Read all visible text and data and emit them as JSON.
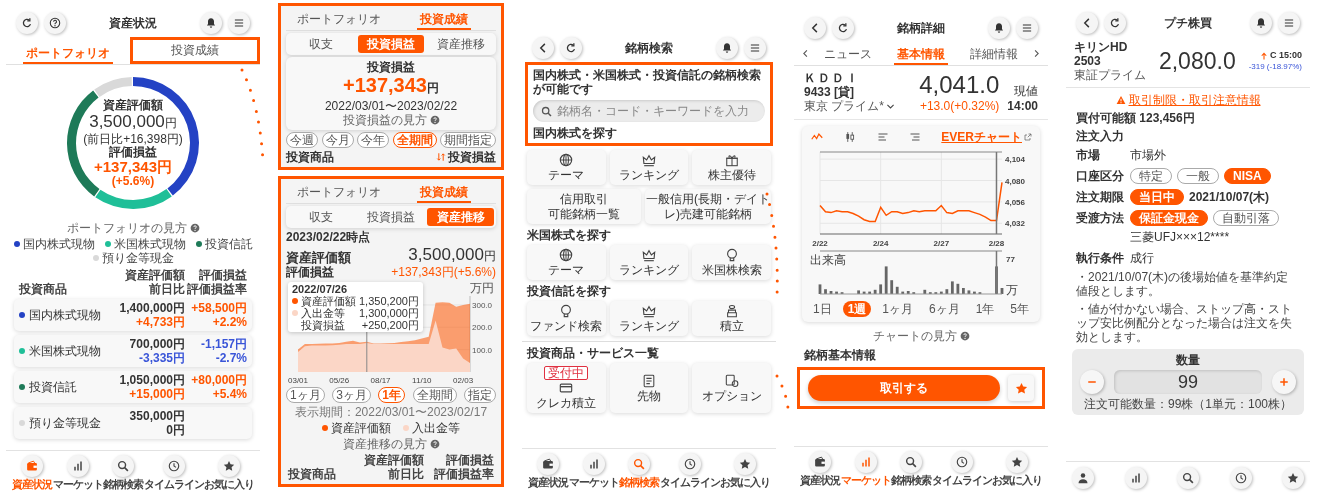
{
  "portfolio_screen": {
    "header": {
      "title": "資産状況",
      "left_icons": [
        {
          "kind": "reload"
        },
        {
          "kind": "help"
        }
      ]
    },
    "tabs": [
      {
        "label": "ポートフォリオ",
        "selected": true,
        "highlighted": false
      },
      {
        "label": "投資成績",
        "selected": false,
        "highlighted": true
      }
    ],
    "chart_data": {
      "type": "donut",
      "categories": [
        "国内株式現物",
        "米国株式現物",
        "投資信託",
        "預り金等現金"
      ],
      "values": [
        40,
        20,
        30,
        10
      ]
    },
    "center": {
      "label": "資産評価額",
      "amount": "3,500,000",
      "unit": "円",
      "day_change": "(前日比+16,398円)",
      "profit_label": "評価損益",
      "profit": "+137,343円",
      "profit_rate": "(+5.6%)"
    },
    "help_link": "ポートフォリオの見方",
    "table": {
      "columns": [
        {
          "lines": [
            "投資商品"
          ]
        },
        {
          "lines": [
            "資産評価額",
            "前日比"
          ]
        },
        {
          "lines": [
            "評価損益",
            "評価損益率"
          ]
        }
      ],
      "rows": [
        {
          "name": "国内株式現物",
          "color": "#2442c4",
          "value": "1,400,000円",
          "day_change": "+4,733円",
          "profit": "+58,500円",
          "profit_rate": "+2.2%",
          "gain": true
        },
        {
          "name": "米国株式現物",
          "color": "#1fbf98",
          "value": "700,000円",
          "day_change": "-3,335円",
          "profit": "-1,157円",
          "profit_rate": "-2.7%",
          "gain": false
        },
        {
          "name": "投資信託",
          "color": "#1e7a58",
          "value": "1,050,000円",
          "day_change": "+15,000円",
          "profit": "+80,000円",
          "profit_rate": "+5.4%",
          "gain": true
        },
        {
          "name": "預り金等現金",
          "color": "#d9d9d9",
          "value": "350,000円",
          "day_change": "0円"
        }
      ]
    },
    "nav": [
      {
        "kind": "wallet",
        "label": "資産状況",
        "selected": true
      },
      {
        "kind": "bars",
        "label": "マーケット",
        "selected": false
      },
      {
        "kind": "search",
        "label": "銘柄検索",
        "selected": false
      },
      {
        "kind": "clock",
        "label": "タイムライン",
        "selected": false
      },
      {
        "kind": "star",
        "label": "お気に入り",
        "selected": false
      }
    ]
  },
  "performance_panels": [
    {
      "kind": "profit",
      "highlighted": true,
      "tabs": [
        {
          "label": "ポートフォリオ",
          "selected": false
        },
        {
          "label": "投資成績",
          "selected": true
        }
      ],
      "segments": [
        {
          "label": "収支",
          "selected": false
        },
        {
          "label": "投資損益",
          "selected": true
        },
        {
          "label": "資産推移",
          "selected": false
        }
      ],
      "summary": {
        "label": "投資損益",
        "amount": "+137,343",
        "unit": "円",
        "period": "2022/03/01〜2023/02/22",
        "help": "投資損益の見方"
      },
      "periods": [
        {
          "label": "今週",
          "selected": false
        },
        {
          "label": "今月",
          "selected": false
        },
        {
          "label": "今年",
          "selected": false
        },
        {
          "label": "全期間",
          "selected": true
        },
        {
          "label": "期間指定",
          "selected": false
        }
      ],
      "list_header": {
        "column_1": "投資商品",
        "sort": "投資損益"
      }
    },
    {
      "kind": "history",
      "highlighted": true,
      "tabs": [
        {
          "label": "ポートフォリオ",
          "selected": false
        },
        {
          "label": "投資成績",
          "selected": true
        }
      ],
      "segments": [
        {
          "label": "収支",
          "selected": false
        },
        {
          "label": "投資損益",
          "selected": false
        },
        {
          "label": "資産推移",
          "selected": true
        }
      ],
      "as_of": "2023/02/22時点",
      "title": "資産評価額",
      "subtitle": "評価損益",
      "amount": "3,500,000",
      "unit": "円",
      "change": "+137,343円(+5.6%)",
      "chart_data": {
        "type": "area",
        "ylabel": "万円",
        "ylim": [
          0,
          340
        ],
        "grid": true,
        "categories": [
          "03/01",
          null,
          null,
          null,
          null,
          null,
          "05/26",
          null,
          null,
          null,
          null,
          null,
          "08/17",
          null,
          null,
          null,
          null,
          null,
          "11/10",
          null,
          null,
          null,
          null,
          null,
          "02/03",
          null
        ],
        "yticks": [
          {
            "value": 100,
            "label": "100.0"
          },
          {
            "value": 200,
            "label": "200.0"
          },
          {
            "value": 300,
            "label": "300.0"
          }
        ],
        "series": [
          {
            "name": "資産評価額",
            "color": "#ff5500",
            "values": [
              100,
              125,
              125,
              126,
              128,
              128,
              130,
              135,
              140,
              132,
              135,
              128,
              128,
              129,
              130,
              134,
              138,
              142,
              150,
              158,
              310,
              312,
              310,
              292,
              300,
              305
            ]
          },
          {
            "name": "入出金等",
            "color": "#fbd6c6",
            "values": [
              90,
              115,
              118,
              118,
              118,
              120,
              122,
              125,
              125,
              125,
              130,
              125,
              125,
              125,
              125,
              125,
              125,
              125,
              125,
              125,
              230,
              110,
              100,
              105,
              60,
              40
            ]
          }
        ]
      },
      "tooltip": {
        "date": "2022/07/26",
        "items": [
          {
            "label": "資産評価額",
            "value": "1,350,200円",
            "color": "#ff5500"
          },
          {
            "label": "入出金等",
            "value": "1,300,000円",
            "color": "#fbd6c6"
          },
          {
            "label": "投資損益",
            "value": "+250,200円"
          }
        ]
      },
      "periods": [
        {
          "label": "1ヶ月",
          "selected": false
        },
        {
          "label": "3ヶ月",
          "selected": false
        },
        {
          "label": "1年",
          "selected": true
        },
        {
          "label": "全期間",
          "selected": false
        },
        {
          "label": "指定",
          "selected": false
        }
      ],
      "display_period": "表示期間：2022/03/01〜2023/02/17",
      "help": "資産推移の見方",
      "columns": [
        {
          "lines": [
            "投資商品"
          ]
        },
        {
          "lines": [
            "資産評価額",
            "前日比"
          ]
        },
        {
          "lines": [
            "評価損益",
            "評価損益率"
          ]
        }
      ]
    }
  ],
  "search_screen": {
    "header": {
      "title": "銘柄検索",
      "left_icons": [
        {
          "kind": "back"
        },
        {
          "kind": "reload"
        }
      ]
    },
    "search_section": {
      "highlighted": true,
      "intro": "国内株式・米国株式・投資信託の銘柄検索が可能です",
      "placeholder": "銘柄名・コード・キーワードを入力"
    },
    "sections": [
      {
        "title": "国内株式を探す",
        "tiles": [
          {
            "kind": "theme",
            "lines": [
              "テーマ"
            ]
          },
          {
            "kind": "ranking",
            "lines": [
              "ランキング"
            ]
          },
          {
            "kind": "benefit",
            "lines": [
              "株主優待"
            ]
          },
          {
            "kind": "text",
            "lines": [
              "信用取引",
              "可能銘柄一覧"
            ]
          },
          {
            "kind": "text",
            "lines": [
              "一般信用(長期・デイト",
              "レ)売建可能銘柄"
            ]
          }
        ]
      },
      {
        "title": "米国株式を探す",
        "tiles": [
          {
            "kind": "theme",
            "lines": [
              "テーマ"
            ]
          },
          {
            "kind": "ranking",
            "lines": [
              "ランキング"
            ]
          },
          {
            "kind": "bulb",
            "lines": [
              "米国株検索"
            ]
          }
        ]
      },
      {
        "title": "投資信託を探す",
        "tiles": [
          {
            "kind": "bulb",
            "lines": [
              "ファンド検索"
            ]
          },
          {
            "kind": "ranking",
            "lines": [
              "ランキング"
            ]
          },
          {
            "kind": "coins",
            "lines": [
              "積立"
            ]
          }
        ]
      },
      {
        "title": "投資商品・サービス一覧",
        "tiles": [
          {
            "kind": "card",
            "lines": [
              "クレカ積立"
            ],
            "badge": "受付中"
          },
          {
            "kind": "futures",
            "lines": [
              "先物"
            ]
          },
          {
            "kind": "option",
            "lines": [
              "オプション"
            ]
          }
        ]
      }
    ],
    "nav": [
      {
        "kind": "wallet",
        "label": "資産状況",
        "selected": false
      },
      {
        "kind": "bars",
        "label": "マーケット",
        "selected": false
      },
      {
        "kind": "search",
        "label": "銘柄検索",
        "selected": true
      },
      {
        "kind": "clock",
        "label": "タイムライン",
        "selected": false
      },
      {
        "kind": "star",
        "label": "お気に入り",
        "selected": false
      }
    ]
  },
  "stock_detail_screen": {
    "header": {
      "title": "銘柄詳細",
      "left_icons": [
        {
          "kind": "back"
        },
        {
          "kind": "reload"
        }
      ]
    },
    "tabs": [
      {
        "label": "ニュース",
        "selected": false
      },
      {
        "label": "基本情報",
        "selected": true
      },
      {
        "label": "詳細情報",
        "selected": false
      }
    ],
    "stock": {
      "name": "ＫＤＤＩ",
      "code": "9433 [貸]",
      "market": "東京 プライム*",
      "price": "4,041.0",
      "price_label": "現値",
      "change": "+13.0(+0.32%)",
      "time": "14:00"
    },
    "chart_tools": [
      {
        "kind": "line",
        "selected": true
      },
      {
        "kind": "candle",
        "selected": false
      },
      {
        "kind": "bars_left",
        "selected": false
      },
      {
        "kind": "bars_right",
        "selected": false
      }
    ],
    "chart_link": "EVERチャート",
    "chart_data": {
      "type": "line",
      "ylim": [
        4020,
        4112
      ],
      "grid": true,
      "categories": [
        "2/22",
        null,
        null,
        null,
        null,
        null,
        null,
        null,
        null,
        null,
        null,
        "2/24",
        null,
        null,
        null,
        null,
        null,
        null,
        null,
        null,
        null,
        null,
        "2/27",
        null,
        null,
        null,
        null,
        null,
        null,
        null,
        null,
        null,
        "2/28",
        null
      ],
      "yticks": [
        {
          "value": 4032,
          "label": "4,032"
        },
        {
          "value": 4056,
          "label": "4,056"
        },
        {
          "value": 4080,
          "label": "4,080"
        },
        {
          "value": 4104,
          "label": "4,104"
        }
      ],
      "series": [
        {
          "color": "#ff5500",
          "values": [
            4052,
            4045,
            4044,
            4046,
            4045,
            4045,
            4043,
            4040,
            4036,
            4034,
            4034,
            4050,
            4041,
            4045,
            4045,
            4043,
            4044,
            4046,
            4045,
            4046,
            4046,
            4046,
            4052,
            4044,
            4043,
            4046,
            4046,
            4046,
            4044,
            4042,
            4039,
            4035,
            4035,
            4078
          ]
        }
      ]
    },
    "volume": {
      "label": "出来高",
      "max": "77",
      "unit": "万"
    },
    "periods": [
      {
        "label": "1日",
        "selected": false
      },
      {
        "label": "1週",
        "selected": true
      },
      {
        "label": "1ヶ月",
        "selected": false
      },
      {
        "label": "6ヶ月",
        "selected": false
      },
      {
        "label": "1年",
        "selected": false
      },
      {
        "label": "5年",
        "selected": false
      }
    ],
    "help": "チャートの見方",
    "section_title": "銘柄基本情報",
    "action_bar": {
      "highlighted": true,
      "button": "取引する"
    },
    "nav": [
      {
        "kind": "wallet",
        "label": "資産状況",
        "selected": false
      },
      {
        "kind": "bars",
        "label": "マーケット",
        "selected": true
      },
      {
        "kind": "search",
        "label": "銘柄検索",
        "selected": false
      },
      {
        "kind": "clock",
        "label": "タイムライン",
        "selected": false
      },
      {
        "kind": "star",
        "label": "お気に入り",
        "selected": false
      }
    ]
  },
  "petit_order_screen": {
    "header": {
      "title": "プチ株買",
      "left_icons": [
        {
          "kind": "back"
        },
        {
          "kind": "reload"
        }
      ]
    },
    "stock": {
      "name": "キリンHD",
      "code": "2503",
      "market": "東証プライム",
      "price": "2,080.0",
      "indicator": "C 15:00",
      "change": "-319 (-18.97%)"
    },
    "warning_link": "取引制限・取引注意情報",
    "buying_power": "買付可能額 123,456円",
    "section_title": "注文入力",
    "rows": [
      {
        "kind": "value",
        "label": "市場",
        "value": "市場外"
      },
      {
        "kind": "choice",
        "label": "口座区分",
        "options": [
          {
            "label": "特定",
            "selected": false
          },
          {
            "label": "一般",
            "selected": false
          },
          {
            "label": "NISA",
            "selected": true
          }
        ]
      },
      {
        "kind": "choice",
        "label": "注文期限",
        "options": [
          {
            "label": "当日中",
            "selected": true
          }
        ],
        "detail": "2021/10/07(木)"
      },
      {
        "kind": "choice",
        "label": "受渡方法",
        "options": [
          {
            "label": "保証金現金",
            "selected": true
          },
          {
            "label": "自動引落",
            "selected": false
          }
        ],
        "sub_detail": "三菱UFJ×××12****"
      },
      {
        "kind": "value",
        "label": "執行条件",
        "value": "成行"
      }
    ],
    "notes": [
      "・2021/10/07(木)の後場始値を基準約定値段とします。",
      "・値が付かない場合、ストップ高・ストップ安比例配分となった場合は注文を失効とします。"
    ],
    "quantity": {
      "label": "数量",
      "value": "99",
      "available": "注文可能数量：99株（1単元：100株）"
    },
    "nav": [
      {
        "kind": "person",
        "selected": false
      },
      {
        "kind": "bars",
        "selected": false
      },
      {
        "kind": "search",
        "selected": false
      },
      {
        "kind": "clock",
        "selected": false
      },
      {
        "kind": "star",
        "selected": false
      }
    ]
  }
}
